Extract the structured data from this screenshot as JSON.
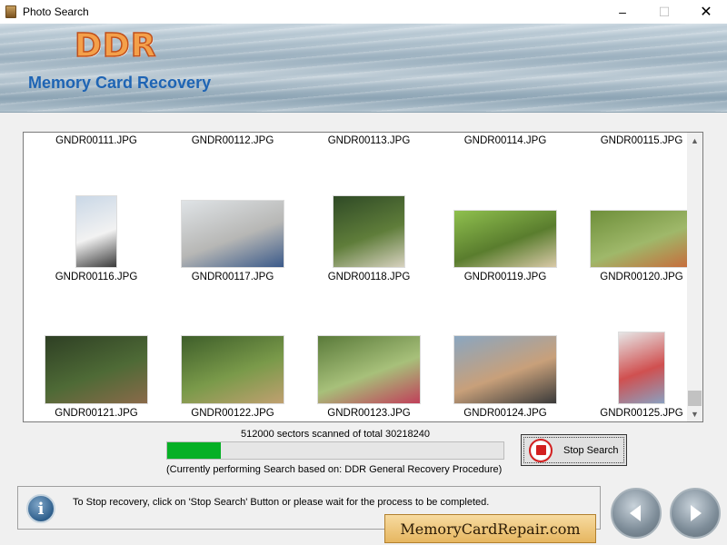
{
  "window": {
    "title": "Photo Search",
    "minimize": "–",
    "maximize": "☐",
    "close": "✕"
  },
  "banner": {
    "brand": "DDR",
    "product": "Memory Card Recovery"
  },
  "results": {
    "rows": [
      [
        {
          "file": "GNDR00111.JPG",
          "has_thumb": false
        },
        {
          "file": "GNDR00112.JPG",
          "has_thumb": false
        },
        {
          "file": "GNDR00113.JPG",
          "has_thumb": false
        },
        {
          "file": "GNDR00114.JPG",
          "has_thumb": false
        },
        {
          "file": "GNDR00115.JPG",
          "has_thumb": false
        }
      ],
      [
        {
          "file": "GNDR00116.JPG",
          "has_thumb": true,
          "palette": [
            "#c9d7e6",
            "#f2f2f2",
            "#3a3a3a"
          ]
        },
        {
          "file": "GNDR00117.JPG",
          "has_thumb": true,
          "palette": [
            "#dfe3e6",
            "#b7b7b5",
            "#3b5a8a"
          ]
        },
        {
          "file": "GNDR00118.JPG",
          "has_thumb": true,
          "palette": [
            "#2f4a26",
            "#5f7d3a",
            "#d8d2c0"
          ]
        },
        {
          "file": "GNDR00119.JPG",
          "has_thumb": true,
          "palette": [
            "#8fc04e",
            "#5a7d2e",
            "#d9c9a8"
          ]
        },
        {
          "file": "GNDR00120.JPG",
          "has_thumb": true,
          "palette": [
            "#6e8f3a",
            "#9fb86a",
            "#c86a3a"
          ]
        }
      ],
      [
        {
          "file": "GNDR00121.JPG",
          "has_thumb": true,
          "palette": [
            "#2e3f24",
            "#4e6a36",
            "#8a6a4a"
          ]
        },
        {
          "file": "GNDR00122.JPG",
          "has_thumb": true,
          "palette": [
            "#3e5e2a",
            "#7a9a4a",
            "#c0a070"
          ]
        },
        {
          "file": "GNDR00123.JPG",
          "has_thumb": true,
          "palette": [
            "#5a7a3a",
            "#a7c07a",
            "#c0405a"
          ]
        },
        {
          "file": "GNDR00124.JPG",
          "has_thumb": true,
          "palette": [
            "#8aa6c0",
            "#c8a07a",
            "#3a3a3a"
          ]
        },
        {
          "file": "GNDR00125.JPG",
          "has_thumb": true,
          "palette": [
            "#e6e6e6",
            "#d05050",
            "#8aa0c0"
          ]
        }
      ]
    ]
  },
  "progress": {
    "sectors_text": "512000 sectors scanned of total 30218240",
    "fraction": 0.16,
    "procedure_text": "(Currently performing Search based on:  DDR General Recovery Procedure)"
  },
  "stop_button": {
    "label": "Stop Search"
  },
  "status": {
    "text": "To Stop recovery, click on 'Stop Search' Button or please wait for the process to be completed."
  },
  "site": {
    "label": "MemoryCardRepair.com"
  }
}
